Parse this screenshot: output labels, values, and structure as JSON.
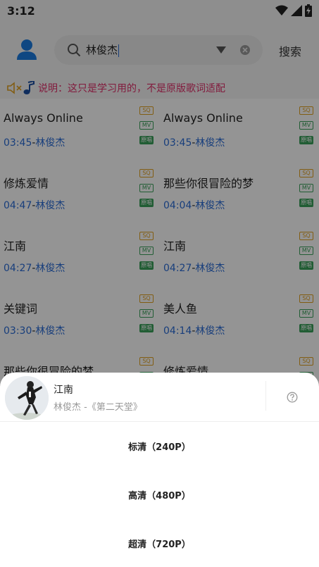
{
  "status_bar": {
    "time": "3:12",
    "icons": [
      "wifi-icon",
      "signal-icon",
      "battery-charging-icon"
    ]
  },
  "header": {
    "profile_icon": "user-icon",
    "search": {
      "value": "林俊杰",
      "search_icon": "search-icon",
      "dropdown_icon": "triangle-down-icon",
      "clear_icon": "clear-circle-icon"
    },
    "search_button": "搜索"
  },
  "notice": {
    "icons": [
      "speaker-icon",
      "music-note-icon"
    ],
    "text": "说明：这只是学习用的，不是原版歌词适配"
  },
  "badges": {
    "sq": "SQ",
    "mv": "MV",
    "lyric": "原唱"
  },
  "colors": {
    "accent_blue": "#2a6cd6",
    "notice_pink": "#e0306a",
    "badge_sq": "#e0a020",
    "badge_green": "#3aa05a"
  },
  "songs": [
    {
      "title": "Always Online",
      "duration": "03:45",
      "separator": "-",
      "artist": "林俊杰"
    },
    {
      "title": "Always Online",
      "duration": "03:45",
      "separator": "-",
      "artist": "林俊杰"
    },
    {
      "title": "修炼爱情",
      "duration": "04:47",
      "separator": "-",
      "artist": "林俊杰"
    },
    {
      "title": "那些你很冒险的梦",
      "duration": "04:04",
      "separator": "-",
      "artist": "林俊杰"
    },
    {
      "title": "江南",
      "duration": "04:27",
      "separator": "-",
      "artist": "林俊杰"
    },
    {
      "title": "江南",
      "duration": "04:27",
      "separator": "-",
      "artist": "林俊杰"
    },
    {
      "title": "关键词",
      "duration": "03:30",
      "separator": "-",
      "artist": "林俊杰"
    },
    {
      "title": "美人鱼",
      "duration": "04:14",
      "separator": "-",
      "artist": "林俊杰"
    },
    {
      "title": "那些你很冒险的梦",
      "duration": "",
      "separator": "",
      "artist": ""
    },
    {
      "title": "修炼爱情",
      "duration": "",
      "separator": "",
      "artist": ""
    }
  ],
  "sheet": {
    "cover_icon": "album-cover",
    "title": "江南",
    "subtitle": "林俊杰 -《第二天堂》",
    "help_icon": "question-circle-icon",
    "options": [
      {
        "label": "标清（240P）"
      },
      {
        "label": "高清（480P）"
      },
      {
        "label": "超清（720P）"
      }
    ]
  }
}
